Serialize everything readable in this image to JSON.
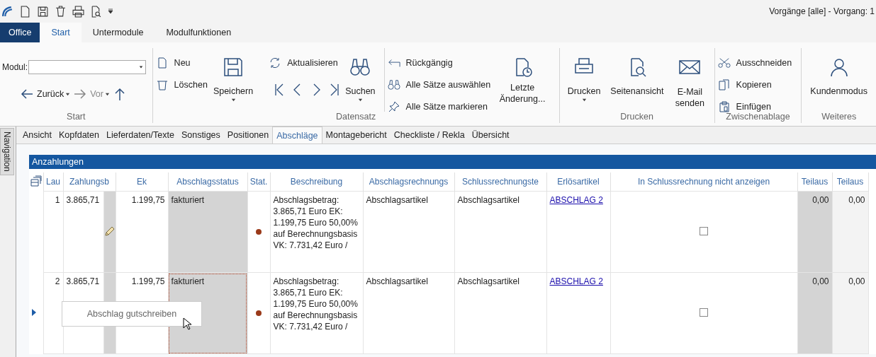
{
  "window": {
    "title": "Vorgänge [alle] - Vorgang: 1"
  },
  "ribbon_tabs": [
    {
      "label": "Office",
      "kind": "app",
      "selected": false
    },
    {
      "label": "Start",
      "kind": "tab",
      "selected": true
    },
    {
      "label": "Untermodule",
      "kind": "tab",
      "selected": false
    },
    {
      "label": "Modulfunktionen",
      "kind": "tab",
      "selected": false
    }
  ],
  "ribbon": {
    "start": {
      "label": "Start",
      "modul_label": "Modul:",
      "back": {
        "label": "Zurück",
        "disabled": false
      },
      "forward": {
        "label": "Vor",
        "disabled": true
      }
    },
    "datensatz": {
      "label": "Datensatz",
      "new": "Neu",
      "delete": "Löschen",
      "save": "Speichern",
      "refresh": "Aktualisieren",
      "search": "Suchen",
      "undo": "Rückgängig",
      "select_all": "Alle Sätze auswählen",
      "mark_all": "Alle Sätze markieren",
      "last_change": "Letzte Änderung..."
    },
    "drucken": {
      "label": "Drucken",
      "print": "Drucken",
      "preview": "Seitenansicht",
      "email": "E-Mail senden"
    },
    "clipboard": {
      "label": "Zwischenablage",
      "cut": "Ausschneiden",
      "copy": "Kopieren",
      "paste": "Einfügen"
    },
    "weiteres": {
      "label": "Weiteres",
      "customer_mode": "Kundenmodus"
    }
  },
  "navigation": {
    "label": "Navigation"
  },
  "tabs": [
    {
      "label": "Ansicht",
      "selected": false
    },
    {
      "label": "Kopfdaten",
      "selected": false
    },
    {
      "label": "Lieferdaten/Texte",
      "selected": false
    },
    {
      "label": "Sonstiges",
      "selected": false
    },
    {
      "label": "Positionen",
      "selected": false
    },
    {
      "label": "Abschläge",
      "selected": true
    },
    {
      "label": "Montagebericht",
      "selected": false
    },
    {
      "label": "Checkliste / Rekla",
      "selected": false
    },
    {
      "label": "Übersicht",
      "selected": false
    }
  ],
  "panel": {
    "title": "Anzahlungen"
  },
  "table": {
    "columns": [
      "Lau",
      "Zahlungsb",
      "Ek",
      "Abschlagsstatus",
      "Stat.",
      "Beschreibung",
      "Abschlagsrechnungs",
      "Schlussrechnungste",
      "Erlösartikel",
      "In Schlussrechnung nicht anzeigen",
      "Teilaus",
      "Teilaus"
    ],
    "rows": [
      {
        "selected": false,
        "lau": "1",
        "zahlungsb": "3.865,71",
        "ek": "1.199,75",
        "status": "fakturiert",
        "beschreibung": "Abschlagsbetrag: 3.865,71 Euro EK: 1.199,75 Euro 50,00% auf Berechnungsbasis VK: 7.731,42 Euro /",
        "abschlagsrechnung": "Abschlagsartikel",
        "schlussrechnung": "Abschlagsartikel",
        "erloesartikel": "ABSCHLAG 2",
        "checked": false,
        "teilaus_1": "0,00",
        "teilaus_2": "0,00"
      },
      {
        "selected": true,
        "lau": "2",
        "zahlungsb": "3.865,71",
        "ek": "1.199,75",
        "status": "fakturiert",
        "beschreibung": "Abschlagsbetrag: 3.865,71 Euro EK: 1.199,75 Euro 50,00% auf Berechnungsbasis VK: 7.731,42 Euro /",
        "abschlagsrechnung": "Abschlagsartikel",
        "schlussrechnung": "Abschlagsartikel",
        "erloesartikel": "ABSCHLAG 2",
        "checked": false,
        "teilaus_1": "0,00",
        "teilaus_2": "0,00"
      }
    ]
  },
  "context_menu": {
    "items": [
      "Abschlag gutschreiben"
    ]
  }
}
